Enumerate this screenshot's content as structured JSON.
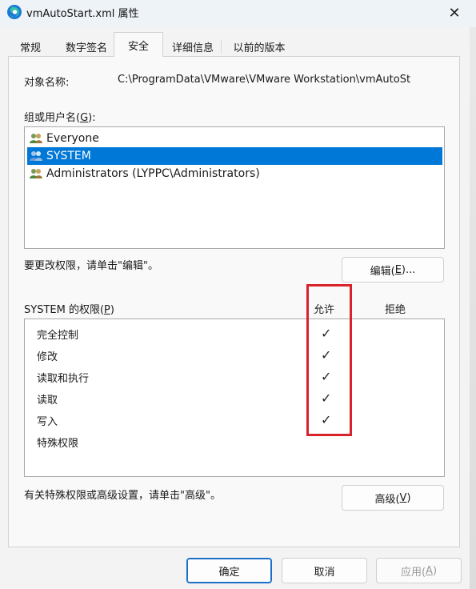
{
  "window": {
    "title": "vmAutoStart.xml 属性",
    "close_glyph": "✕",
    "app_icon": "edge-file-icon",
    "accent_color": "#0078d7"
  },
  "tabs": [
    {
      "label": "常规"
    },
    {
      "label": "数字签名"
    },
    {
      "label": "安全",
      "active": true
    },
    {
      "label": "详细信息"
    },
    {
      "label": "以前的版本"
    }
  ],
  "security": {
    "object_name_label": "对象名称:",
    "object_name_value": "C:\\ProgramData\\VMware\\VMware Workstation\\vmAutoSt",
    "groups_label_prefix": "组或用户名(",
    "groups_label_key": "G",
    "groups_label_suffix": "):",
    "users": [
      {
        "name": "Everyone",
        "selected": false
      },
      {
        "name": "SYSTEM",
        "selected": true
      },
      {
        "name": "Administrators (LYPPC\\Administrators)",
        "selected": false
      }
    ],
    "edit_hint": "要更改权限，请单击\"编辑\"。",
    "edit_button": {
      "prefix": "编辑(",
      "key": "E",
      "suffix": ")..."
    },
    "perm_header_prefix": "SYSTEM 的权限(",
    "perm_header_key": "P",
    "perm_header_suffix": ")",
    "allow_header": "允许",
    "deny_header": "拒绝",
    "permissions": [
      {
        "name": "完全控制",
        "allow": "✓",
        "deny": ""
      },
      {
        "name": "修改",
        "allow": "✓",
        "deny": ""
      },
      {
        "name": "读取和执行",
        "allow": "✓",
        "deny": ""
      },
      {
        "name": "读取",
        "allow": "✓",
        "deny": ""
      },
      {
        "name": "写入",
        "allow": "✓",
        "deny": ""
      },
      {
        "name": "特殊权限",
        "allow": "",
        "deny": ""
      }
    ],
    "advanced_hint": "有关特殊权限或高级设置，请单击\"高级\"。",
    "advanced_button": {
      "prefix": "高级(",
      "key": "V",
      "suffix": ")"
    },
    "highlight_color": "#d9232a"
  },
  "footer": {
    "ok_label": "确定",
    "cancel_label": "取消",
    "apply": {
      "prefix": "应用(",
      "key": "A",
      "suffix": ")"
    }
  }
}
